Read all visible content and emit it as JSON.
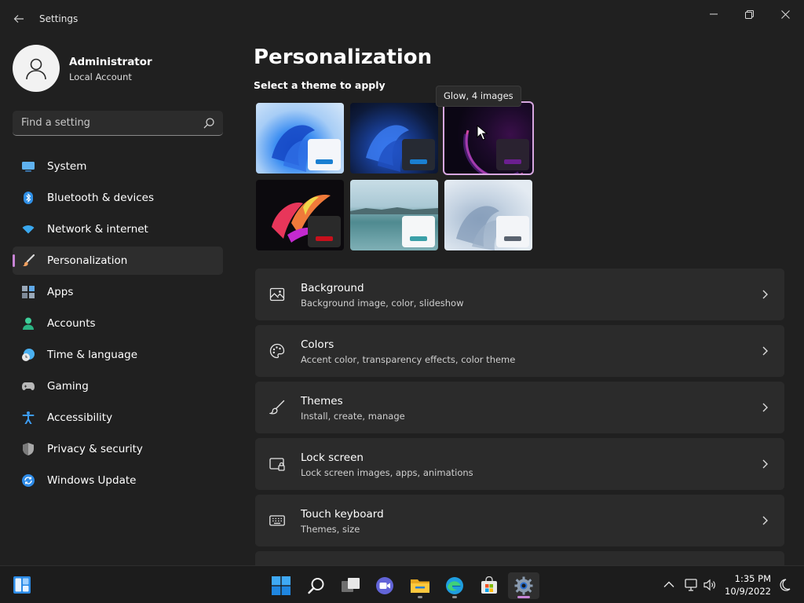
{
  "window": {
    "title": "Settings"
  },
  "user": {
    "name": "Administrator",
    "account_type": "Local Account"
  },
  "search": {
    "placeholder": "Find a setting"
  },
  "sidebar": {
    "items": [
      {
        "label": "System",
        "icon": "monitor-icon",
        "color": "#5fb2f0"
      },
      {
        "label": "Bluetooth & devices",
        "icon": "bluetooth-icon",
        "color": "#2f8fe6"
      },
      {
        "label": "Network & internet",
        "icon": "wifi-icon",
        "color": "#3aa8ef"
      },
      {
        "label": "Personalization",
        "icon": "brush-icon",
        "color": "#f0a060",
        "active": true
      },
      {
        "label": "Apps",
        "icon": "apps-icon",
        "color": "#9aa8b8"
      },
      {
        "label": "Accounts",
        "icon": "person-icon",
        "color": "#3ecf9a"
      },
      {
        "label": "Time & language",
        "icon": "globe-clock-icon",
        "color": "#4ab0f0"
      },
      {
        "label": "Gaming",
        "icon": "gamepad-icon",
        "color": "#b8b8b8"
      },
      {
        "label": "Accessibility",
        "icon": "accessibility-icon",
        "color": "#3d9cf0"
      },
      {
        "label": "Privacy & security",
        "icon": "shield-icon",
        "color": "#a8a8a8"
      },
      {
        "label": "Windows Update",
        "icon": "update-icon",
        "color": "#2d8be8"
      }
    ]
  },
  "main": {
    "title": "Personalization",
    "theme_heading": "Select a theme to apply",
    "tooltip": "Glow, 4 images",
    "themes": [
      {
        "name": "windows-light",
        "bar_color": "#1a7fd1",
        "win_color": "#f4f6fa",
        "selected": false
      },
      {
        "name": "windows-dark",
        "bar_color": "#1a7fd1",
        "win_color": "#262a33",
        "selected": false
      },
      {
        "name": "glow",
        "bar_color": "#6b1f8f",
        "win_color": "#2a2230",
        "selected": true
      },
      {
        "name": "captured-motion",
        "bar_color": "#c8101c",
        "win_color": "#2a2a2a",
        "selected": false
      },
      {
        "name": "sunrise",
        "bar_color": "#3aa0a8",
        "win_color": "#f5f7f8",
        "selected": false
      },
      {
        "name": "flow",
        "bar_color": "#5a6370",
        "win_color": "#f3f5f8",
        "selected": false
      }
    ],
    "cards": [
      {
        "title": "Background",
        "subtitle": "Background image, color, slideshow",
        "icon": "image-icon"
      },
      {
        "title": "Colors",
        "subtitle": "Accent color, transparency effects, color theme",
        "icon": "palette-icon"
      },
      {
        "title": "Themes",
        "subtitle": "Install, create, manage",
        "icon": "paintbrush-icon"
      },
      {
        "title": "Lock screen",
        "subtitle": "Lock screen images, apps, animations",
        "icon": "lock-screen-icon"
      },
      {
        "title": "Touch keyboard",
        "subtitle": "Themes, size",
        "icon": "keyboard-icon"
      }
    ]
  },
  "taskbar": {
    "apps": [
      "windows-start-icon",
      "search-icon",
      "task-view-icon",
      "teams-chat-icon",
      "file-explorer-icon",
      "edge-icon",
      "store-icon",
      "settings-icon"
    ],
    "clock": {
      "time": "1:35 PM",
      "date": "10/9/2022"
    }
  },
  "colors": {
    "accent": "#c884d6",
    "background": "#202020",
    "card": "#2b2b2b"
  }
}
